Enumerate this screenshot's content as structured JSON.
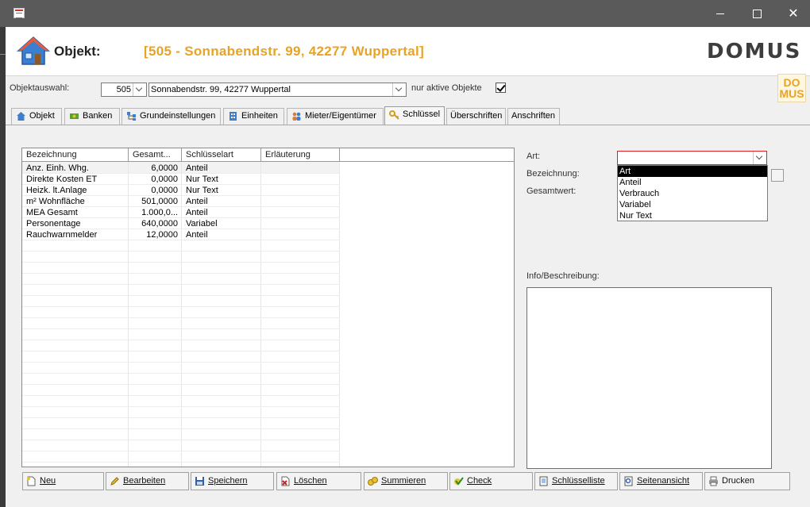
{
  "header": {
    "label": "Objekt:",
    "title": "[505 - Sonnabendstr. 99, 42277 Wuppertal]",
    "logo": "DOMUS",
    "mini_logo_top": "DO",
    "mini_logo_bottom": "MUS"
  },
  "selection": {
    "label": "Objektauswahl:",
    "number": "505",
    "address": "Sonnabendstr. 99, 42277 Wuppertal",
    "active_label": "nur aktive Objekte",
    "active_checked": true
  },
  "tabs": [
    {
      "label": "Objekt",
      "icon": "house-icon"
    },
    {
      "label": "Banken",
      "icon": "money-icon"
    },
    {
      "label": "Grundeinstellungen",
      "icon": "settings-tree-icon"
    },
    {
      "label": "Einheiten",
      "icon": "building-icon"
    },
    {
      "label": "Mieter/Eigentümer",
      "icon": "people-icon"
    },
    {
      "label": "Schlüssel",
      "icon": "key-icon",
      "active": true
    },
    {
      "label": "Überschriften"
    },
    {
      "label": "Anschriften"
    }
  ],
  "grid": {
    "columns": [
      "Bezeichnung",
      "Gesamt...",
      "Schlüsselart",
      "Erläuterung"
    ],
    "rows": [
      [
        "Anz. Einh. Whg.",
        "6,0000",
        "Anteil",
        ""
      ],
      [
        "Direkte Kosten ET",
        "0,0000",
        "Nur Text",
        ""
      ],
      [
        "Heizk. lt.Anlage",
        "0,0000",
        "Nur Text",
        ""
      ],
      [
        "m² Wohnfläche",
        "501,0000",
        "Anteil",
        ""
      ],
      [
        "MEA Gesamt",
        "1.000,0...",
        "Anteil",
        ""
      ],
      [
        "Personentage",
        "640,0000",
        "Variabel",
        ""
      ],
      [
        "Rauchwarnmelder",
        "12,0000",
        "Anteil",
        ""
      ]
    ]
  },
  "form": {
    "art_label": "Art:",
    "bezeichnung_label": "Bezeichnung:",
    "gesamtwert_label": "Gesamtwert:",
    "info_label": "Info/Beschreibung:",
    "art_value": "",
    "art_options": [
      "Art",
      "Anteil",
      "Verbrauch",
      "Variabel",
      "Nur Text"
    ],
    "art_highlighted": "Art"
  },
  "toolbar": [
    {
      "label": "Neu",
      "icon": "new-document-icon"
    },
    {
      "label": "Bearbeiten",
      "icon": "edit-pencil-icon"
    },
    {
      "label": "Speichern",
      "icon": "save-disk-icon"
    },
    {
      "label": "Löschen",
      "icon": "delete-icon"
    },
    {
      "label": "Summieren",
      "icon": "coins-icon"
    },
    {
      "label": "Check",
      "icon": "check-icon"
    },
    {
      "label": "Schlüsselliste",
      "icon": "list-document-icon"
    },
    {
      "label": "Seitenansicht",
      "icon": "preview-icon"
    },
    {
      "label": "Drucken",
      "icon": "printer-icon"
    }
  ],
  "colors": {
    "title_accent": "#e8a325",
    "titlebar": "#5a5a5a",
    "focus_border": "#e02020"
  }
}
